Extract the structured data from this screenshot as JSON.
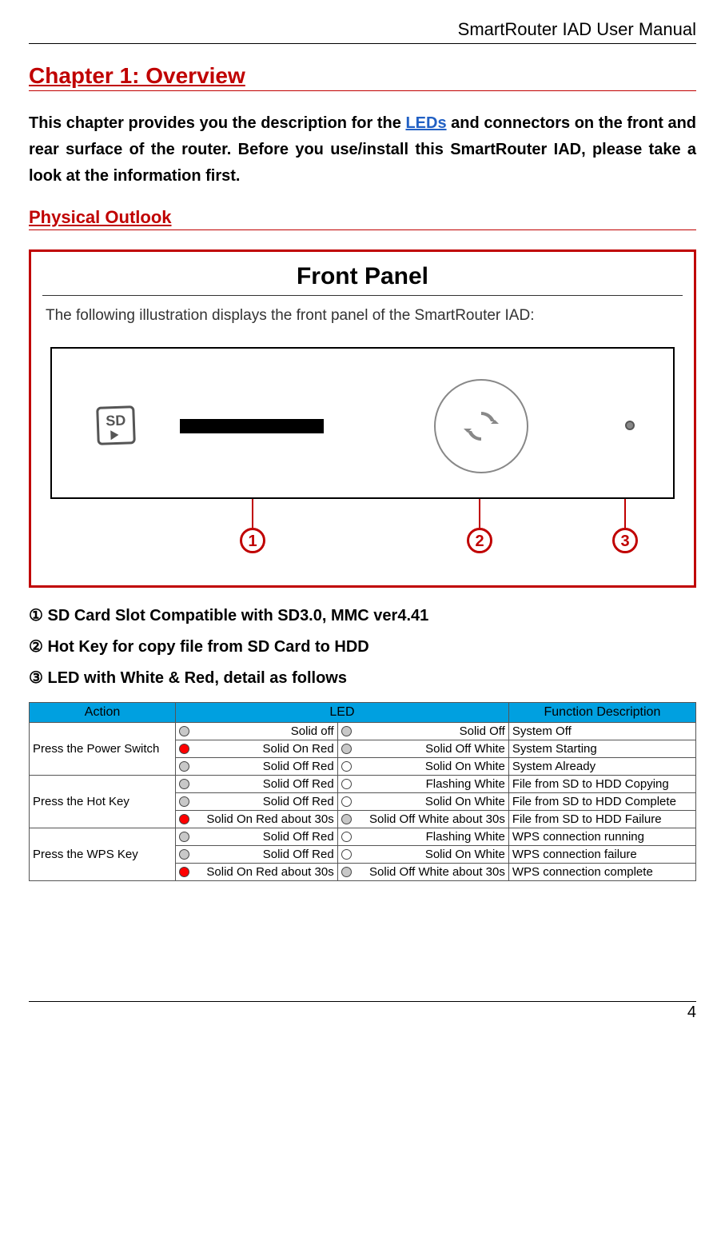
{
  "header": {
    "title": "SmartRouter IAD User Manual"
  },
  "chapter": {
    "title": "Chapter 1: Overview"
  },
  "intro": {
    "part1": "This chapter provides you the description for the ",
    "link": "LEDs",
    "part2": " and connectors on the front and rear surface of the router. Before you use/install this SmartRouter IAD, please take a look at the information first."
  },
  "section": {
    "physical_outlook": "Physical Outlook"
  },
  "front_panel": {
    "title": "Front Panel",
    "description": "The following illustration displays the front panel of the SmartRouter IAD:",
    "sd_label": "SD",
    "callouts": {
      "c1": "1",
      "c2": "2",
      "c3": "3"
    }
  },
  "bullets": {
    "b1": "① SD Card Slot Compatible with SD3.0, MMC ver4.41",
    "b2": "② Hot Key for copy file from SD Card to HDD",
    "b3": "③ LED with White & Red, detail as follows"
  },
  "led_table": {
    "headers": {
      "action": "Action",
      "led": "LED",
      "func": "Function Description"
    },
    "groups": [
      {
        "action": "Press the Power Switch",
        "rows": [
          {
            "l1c": "grey",
            "l1t": "Solid off",
            "l2c": "grey",
            "l2t": "Solid Off",
            "func": "System Off"
          },
          {
            "l1c": "red",
            "l1t": "Solid On Red",
            "l2c": "grey",
            "l2t": "Solid Off White",
            "func": "System Starting"
          },
          {
            "l1c": "grey",
            "l1t": "Solid Off Red",
            "l2c": "open",
            "l2t": "Solid On White",
            "func": "System Already"
          }
        ]
      },
      {
        "action": "Press the Hot Key",
        "rows": [
          {
            "l1c": "grey",
            "l1t": "Solid Off Red",
            "l2c": "open",
            "l2t": "Flashing White",
            "func": "File from SD to HDD Copying"
          },
          {
            "l1c": "grey",
            "l1t": "Solid Off Red",
            "l2c": "open",
            "l2t": "Solid On White",
            "func": "File from SD to HDD Complete"
          },
          {
            "l1c": "red",
            "l1t": "Solid On Red about 30s",
            "l2c": "grey",
            "l2t": "Solid Off White about 30s",
            "func": "File from SD to HDD Failure"
          }
        ]
      },
      {
        "action": "Press the WPS Key",
        "rows": [
          {
            "l1c": "grey",
            "l1t": "Solid Off Red",
            "l2c": "open",
            "l2t": "Flashing White",
            "func": "WPS connection running"
          },
          {
            "l1c": "grey",
            "l1t": "Solid Off Red",
            "l2c": "open",
            "l2t": "Solid On White",
            "func": "WPS connection failure"
          },
          {
            "l1c": "red",
            "l1t": "Solid On Red about 30s",
            "l2c": "grey",
            "l2t": "Solid Off White about 30s",
            "func": "WPS connection complete"
          }
        ]
      }
    ]
  },
  "page": {
    "number": "4"
  }
}
